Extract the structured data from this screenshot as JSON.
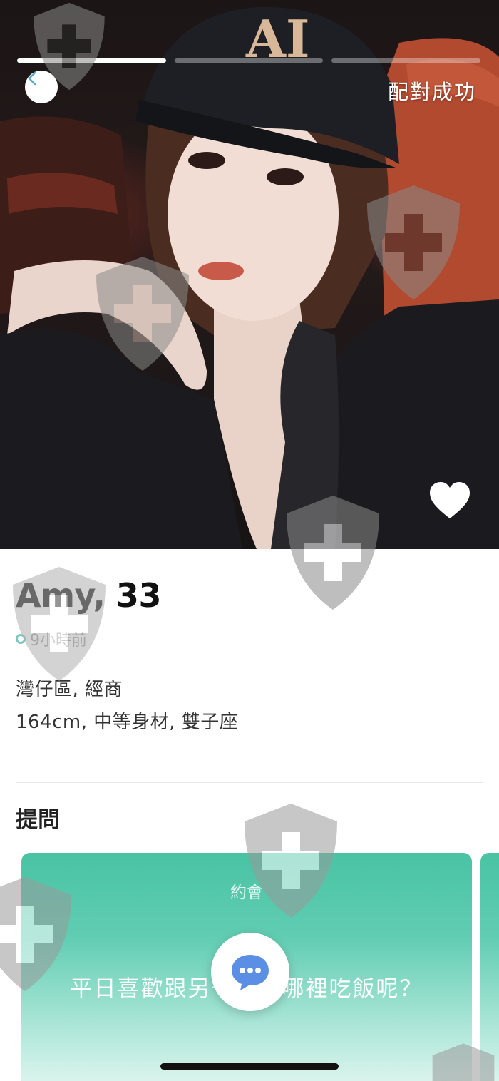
{
  "photo": {
    "match_status": "配對成功",
    "progress_segments": 3,
    "progress_active_index": 0
  },
  "profile": {
    "name_age": "Amy, 33",
    "last_active": "9小時前",
    "location_job": "灣仔區, 經商",
    "details": "164cm, 中等身材, 雙子座"
  },
  "questions": {
    "section_title": "提問",
    "card": {
      "tag": "約會",
      "text": "平日喜歡跟另一半去哪裡吃飯呢？"
    }
  },
  "colors": {
    "accent_teal": "#49c3a4",
    "online_dot": "#7cc8c0",
    "chat_bubble": "#5b8fe6"
  },
  "icons": {
    "back": "chevron-left-icon",
    "like": "heart-icon",
    "chat": "chat-bubble-icon",
    "watermark": "shield-cross-icon"
  }
}
